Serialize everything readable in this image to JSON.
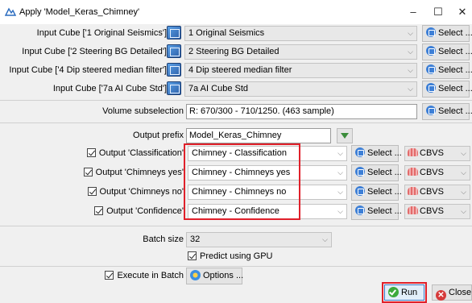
{
  "window": {
    "title": "Apply 'Model_Keras_Chimney'",
    "minimize": "–",
    "maximize": "☐",
    "close": "✕"
  },
  "inputs": [
    {
      "label": "Input Cube ['1 Original Seismics']",
      "value": "1 Original Seismics",
      "button": "Select ..."
    },
    {
      "label": "Input Cube ['2 Steering BG Detailed']",
      "value": "2 Steering BG Detailed",
      "button": "Select ..."
    },
    {
      "label": "Input Cube ['4 Dip steered median filter']",
      "value": "4 Dip steered median filter",
      "button": "Select ..."
    },
    {
      "label": "Input Cube ['7a AI Cube Std']",
      "value": "7a AI Cube Std",
      "button": "Select ..."
    }
  ],
  "volume": {
    "label": "Volume subselection",
    "value": "R: 670/300 - 710/1250. (463 sample)",
    "button": "Select ..."
  },
  "output_prefix": {
    "label": "Output prefix",
    "value": "Model_Keras_Chimney"
  },
  "outputs": [
    {
      "label": "Output 'Classification'",
      "value": "Chimney - Classification",
      "button": "Select ...",
      "format": "CBVS"
    },
    {
      "label": "Output 'Chimneys yes'",
      "value": "Chimney - Chimneys yes",
      "button": "Select ...",
      "format": "CBVS"
    },
    {
      "label": "Output 'Chimneys no'",
      "value": "Chimney - Chimneys no",
      "button": "Select ...",
      "format": "CBVS"
    },
    {
      "label": "Output 'Confidence'",
      "value": "Chimney - Confidence",
      "button": "Select ...",
      "format": "CBVS"
    }
  ],
  "batch": {
    "label": "Batch size",
    "value": "32"
  },
  "gpu": {
    "label": "Predict using GPU"
  },
  "execute": {
    "label": "Execute in Batch",
    "options_button": "Options ..."
  },
  "footer": {
    "run": "Run",
    "close": "Close"
  },
  "colors": {
    "highlight": "#e0202a",
    "run_icon": "#3caa3c",
    "close_icon": "#d63a3a"
  }
}
